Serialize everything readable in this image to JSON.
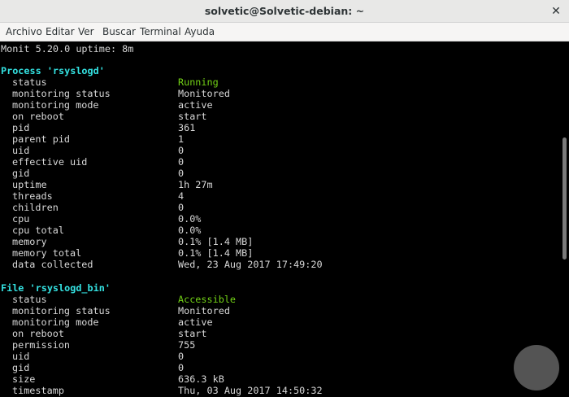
{
  "window": {
    "title": "solvetic@Solvetic-debian: ~",
    "close_glyph": "✕"
  },
  "menu": [
    "Archivo",
    "Editar",
    "Ver",
    "Buscar",
    "Terminal",
    "Ayuda"
  ],
  "terminal": {
    "intro": "Monit 5.20.0 uptime: 8m",
    "process_header": "Process 'rsyslogd'",
    "process_rows": [
      {
        "key": "status",
        "value": "Running"
      },
      {
        "key": "monitoring status",
        "value": "Monitored"
      },
      {
        "key": "monitoring mode",
        "value": "active"
      },
      {
        "key": "on reboot",
        "value": "start"
      },
      {
        "key": "pid",
        "value": "361"
      },
      {
        "key": "parent pid",
        "value": "1"
      },
      {
        "key": "uid",
        "value": "0"
      },
      {
        "key": "effective uid",
        "value": "0"
      },
      {
        "key": "gid",
        "value": "0"
      },
      {
        "key": "uptime",
        "value": "1h 27m"
      },
      {
        "key": "threads",
        "value": "4"
      },
      {
        "key": "children",
        "value": "0"
      },
      {
        "key": "cpu",
        "value": "0.0%"
      },
      {
        "key": "cpu total",
        "value": "0.0%"
      },
      {
        "key": "memory",
        "value": "0.1% [1.4 MB]"
      },
      {
        "key": "memory total",
        "value": "0.1% [1.4 MB]"
      },
      {
        "key": "data collected",
        "value": "Wed, 23 Aug 2017 17:49:20"
      }
    ],
    "file_header": "File 'rsyslogd_bin'",
    "file_rows": [
      {
        "key": "status",
        "value": "Accessible"
      },
      {
        "key": "monitoring status",
        "value": "Monitored"
      },
      {
        "key": "monitoring mode",
        "value": "active"
      },
      {
        "key": "on reboot",
        "value": "start"
      },
      {
        "key": "permission",
        "value": "755"
      },
      {
        "key": "uid",
        "value": "0"
      },
      {
        "key": "gid",
        "value": "0"
      },
      {
        "key": "size",
        "value": "636.3 kB"
      },
      {
        "key": "timestamp",
        "value": "Thu, 03 Aug 2017 14:50:32"
      }
    ]
  },
  "colors": {
    "header": "#34e2e2",
    "status_ok": "#73d216",
    "text": "#d8d8d8",
    "background": "#000000"
  }
}
